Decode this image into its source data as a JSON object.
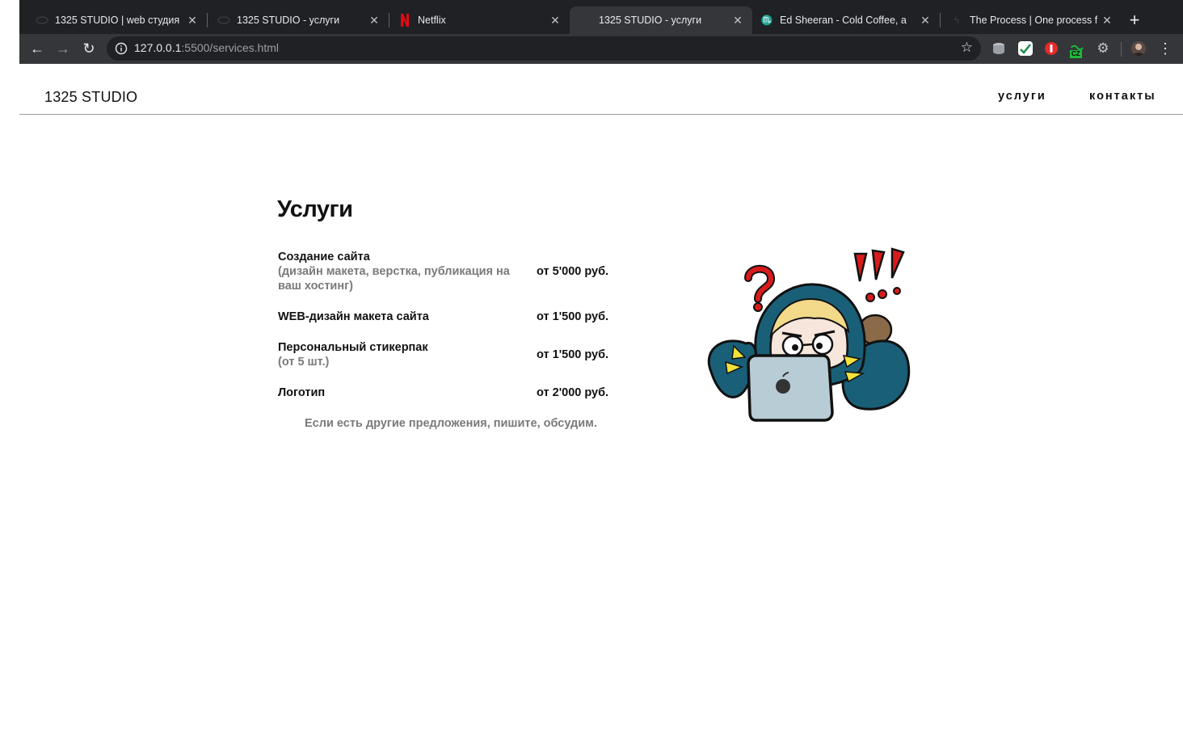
{
  "browser": {
    "tabs": [
      {
        "title": "1325 STUDIO | web студия",
        "favicon": "eye-icon",
        "active": false
      },
      {
        "title": "1325 STUDIO - услуги",
        "favicon": "eye-icon",
        "active": false
      },
      {
        "title": "Netflix",
        "favicon": "netflix-icon",
        "active": false
      },
      {
        "title": "1325 STUDIO - услуги",
        "favicon": "none",
        "active": true
      },
      {
        "title": "Ed Sheeran - Cold Coffee, a",
        "favicon": "music-icon",
        "active": false
      },
      {
        "title": "The Process | One process f",
        "favicon": "bolt-icon",
        "active": false
      }
    ],
    "url_host": "127.0.0.1",
    "url_path": ":5500/services.html",
    "extension_badge": "CZ",
    "colors": {
      "chrome": "#202124",
      "toolbar": "#35363a",
      "netflix": "#e50914",
      "badge": "#1db93a"
    }
  },
  "site": {
    "logo": "1325 STUDIO",
    "nav": [
      "услуги",
      "контакты"
    ]
  },
  "services": {
    "title": "Услуги",
    "items": [
      {
        "name": "Создание сайта",
        "desc": "(дизайн макета, верстка, публикация на ваш хостинг)",
        "price": "от 5'000 руб."
      },
      {
        "name": "WEB-дизайн макета сайта",
        "desc": "",
        "price": "от 1'500 руб."
      },
      {
        "name": "Персональный стикерпак",
        "desc": "(от 5 шт.)",
        "price": "от 1'500 руб."
      },
      {
        "name": "Логотип",
        "desc": "",
        "price": "от 2'000 руб."
      }
    ],
    "note": "Если есть другие предложения, пишите, обсудим.",
    "illustration": "confused-character-with-laptop-sticker"
  }
}
